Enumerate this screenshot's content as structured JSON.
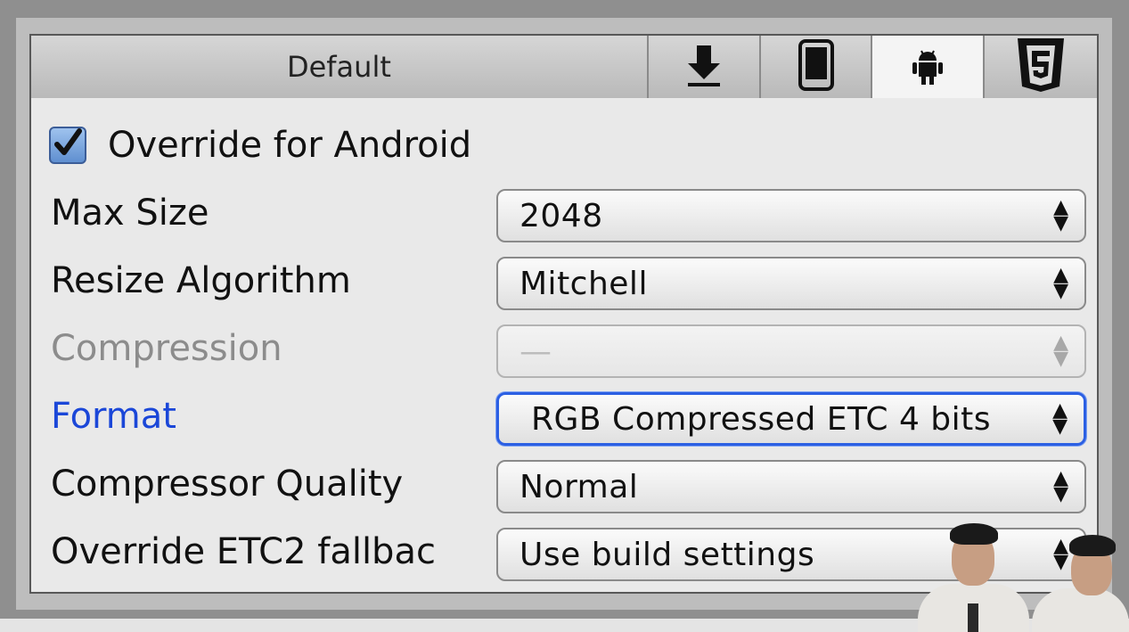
{
  "tabs": {
    "default_label": "Default",
    "icons": [
      "download-icon",
      "mobile-device-icon",
      "android-icon",
      "html5-icon"
    ],
    "active_index": 2
  },
  "override": {
    "label": "Override for Android",
    "checked": true
  },
  "settings": [
    {
      "label": "Max Size",
      "value": "2048",
      "state": "normal"
    },
    {
      "label": "Resize Algorithm",
      "value": "Mitchell",
      "state": "normal"
    },
    {
      "label": "Compression",
      "value": "—",
      "state": "disabled"
    },
    {
      "label": "Format",
      "value": "RGB Compressed ETC 4 bits",
      "state": "focused"
    },
    {
      "label": "Compressor Quality",
      "value": "Normal",
      "state": "normal"
    },
    {
      "label": "Override ETC2 fallbac",
      "value": "Use build settings",
      "state": "normal"
    }
  ],
  "colors": {
    "highlight": "#1b47d8",
    "disabled": "#8c8c8c"
  }
}
